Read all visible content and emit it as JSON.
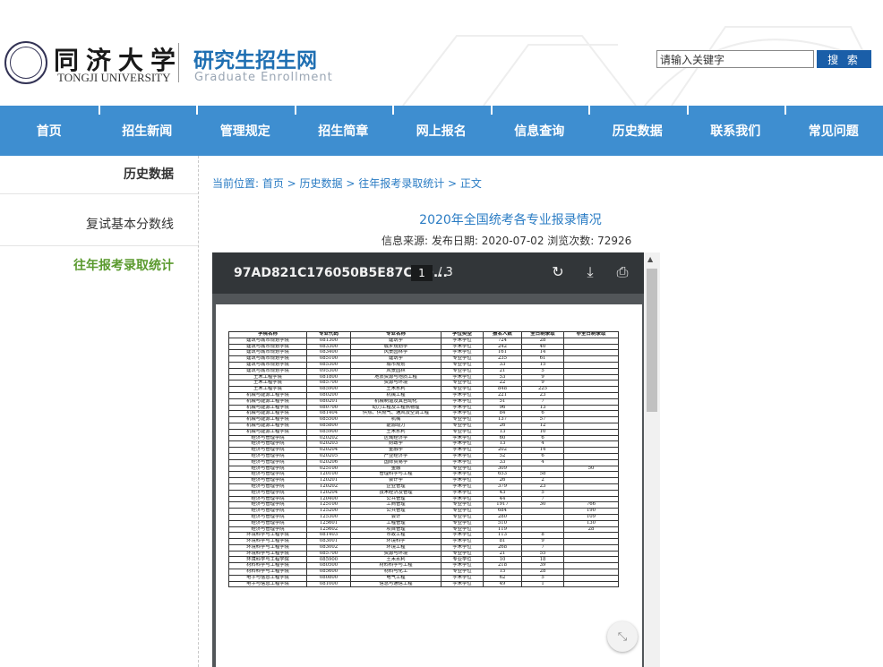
{
  "header": {
    "university_cn": "同济大学",
    "university_en": "TONGJI UNIVERSITY",
    "site_title": "研究生招生网",
    "site_subtitle": "Graduate Enrollment",
    "search_placeholder": "请输入关键字",
    "search_button": "搜 索"
  },
  "nav": [
    "首页",
    "招生新闻",
    "管理规定",
    "招生简章",
    "网上报名",
    "信息查询",
    "历史数据",
    "联系我们",
    "常见问题"
  ],
  "sidebar": {
    "heading": "历史数据",
    "items": [
      {
        "label": "复试基本分数线",
        "active": false
      },
      {
        "label": "往年报考录取统计",
        "active": true
      }
    ]
  },
  "breadcrumb": "当前位置:  首页 > 历史数据 > 往年报考录取统计 > 正文",
  "article": {
    "title": "2020年全国统考各专业报录情况",
    "meta": "信息来源:  发布日期: 2020-07-02 浏览次数: 72926"
  },
  "viewer": {
    "doc_name": "97AD821C176050B5E87CDD...",
    "page": "1",
    "total": "/ 3",
    "icons": {
      "rotate": "rotate-icon",
      "download": "download-icon",
      "print": "print-icon",
      "fit": "fit-page-icon"
    },
    "accent": "#323639"
  },
  "table": {
    "headers": [
      "学院名称",
      "专业代码",
      "专业名称",
      "学位类型",
      "报名人数",
      "全日制录取",
      "非全日制录取"
    ],
    "rows": [
      [
        "建筑与城市规划学院",
        "081300",
        "建筑学",
        "学术学位",
        "724",
        "28",
        ""
      ],
      [
        "建筑与城市规划学院",
        "083300",
        "城乡规划学",
        "学术学位",
        "242",
        "40",
        ""
      ],
      [
        "建筑与城市规划学院",
        "083400",
        "风景园林学",
        "学术学位",
        "161",
        "14",
        ""
      ],
      [
        "建筑与城市规划学院",
        "085100",
        "建筑学",
        "专业学位",
        "235",
        "61",
        ""
      ],
      [
        "建筑与城市规划学院",
        "085300",
        "城市规划",
        "专业学位",
        "33",
        "15",
        ""
      ],
      [
        "建筑与城市规划学院",
        "095300",
        "风景园林",
        "专业学位",
        "21",
        "5",
        ""
      ],
      [
        "土木工程学院",
        "081800",
        "地质资源与地质工程",
        "学术学位",
        "53",
        "9",
        ""
      ],
      [
        "土木工程学院",
        "085700",
        "资源与环境",
        "专业学位",
        "22",
        "9",
        ""
      ],
      [
        "土木工程学院",
        "085900",
        "土木水利",
        "专业学位",
        "848",
        "225",
        ""
      ],
      [
        "机械与能源工程学院",
        "080200",
        "机械工程",
        "学术学位",
        "221",
        "23",
        ""
      ],
      [
        "机械与能源工程学院",
        "080201",
        "机械制造及其自动化",
        "学术学位",
        "51",
        "7",
        ""
      ],
      [
        "机械与能源工程学院",
        "080700",
        "动力工程及工程热物理",
        "学术学位",
        "96",
        "13",
        ""
      ],
      [
        "机械与能源工程学院",
        "081404",
        "供热、供燃气、通风及空调工程",
        "学术学位",
        "84",
        "6",
        ""
      ],
      [
        "机械与能源工程学院",
        "085500",
        "机械",
        "专业学位",
        "137",
        "57",
        ""
      ],
      [
        "机械与能源工程学院",
        "085800",
        "能源动力",
        "专业学位",
        "26",
        "12",
        ""
      ],
      [
        "机械与能源工程学院",
        "085900",
        "土木水利",
        "专业学位",
        "13",
        "10",
        ""
      ],
      [
        "经济与管理学院",
        "020202",
        "区域经济学",
        "学术学位",
        "60",
        "6",
        ""
      ],
      [
        "经济与管理学院",
        "020203",
        "财政学",
        "学术学位",
        "13",
        "4",
        ""
      ],
      [
        "经济与管理学院",
        "020204",
        "金融学",
        "学术学位",
        "202",
        "14",
        ""
      ],
      [
        "经济与管理学院",
        "020205",
        "产业经济学",
        "学术学位",
        "52",
        "6",
        ""
      ],
      [
        "经济与管理学院",
        "020206",
        "国际贸易学",
        "学术学位",
        "33",
        "4",
        ""
      ],
      [
        "经济与管理学院",
        "025100",
        "金融",
        "专业学位",
        "309",
        "",
        "50"
      ],
      [
        "经济与管理学院",
        "120100",
        "管理科学与工程",
        "学术学位",
        "653",
        "58",
        ""
      ],
      [
        "经济与管理学院",
        "120201",
        "会计学",
        "学术学位",
        "26",
        "2",
        ""
      ],
      [
        "经济与管理学院",
        "120202",
        "企业管理",
        "学术学位",
        "379",
        "23",
        ""
      ],
      [
        "经济与管理学院",
        "120204",
        "技术经济及管理",
        "学术学位",
        "43",
        "5",
        ""
      ],
      [
        "经济与管理学院",
        "120400",
        "公共管理",
        "学术学位",
        "44",
        "7",
        ""
      ],
      [
        "经济与管理学院",
        "125100",
        "工商管理",
        "专业学位",
        "1917",
        "30",
        "766"
      ],
      [
        "经济与管理学院",
        "125200",
        "公共管理",
        "专业学位",
        "684",
        "",
        "190"
      ],
      [
        "经济与管理学院",
        "125300",
        "会计",
        "专业学位",
        "280",
        "",
        "109"
      ],
      [
        "经济与管理学院",
        "125601",
        "工程管理",
        "专业学位",
        "510",
        "",
        "130"
      ],
      [
        "经济与管理学院",
        "125602",
        "项目管理",
        "专业学位",
        "119",
        "",
        "28"
      ],
      [
        "环境科学与工程学院",
        "081403",
        "市政工程",
        "学术学位",
        "113",
        "8",
        ""
      ],
      [
        "环境科学与工程学院",
        "083001",
        "环境科学",
        "学术学位",
        "81",
        "9",
        ""
      ],
      [
        "环境科学与工程学院",
        "083002",
        "环境工程",
        "学术学位",
        "268",
        "7",
        ""
      ],
      [
        "环境科学与工程学院",
        "085700",
        "资源与环境",
        "专业学位",
        "21",
        "55",
        ""
      ],
      [
        "环境科学与工程学院",
        "085900",
        "土木水利",
        "专业学位",
        "10",
        "18",
        ""
      ],
      [
        "材料科学与工程学院",
        "080500",
        "材料科学与工程",
        "学术学位",
        "218",
        "39",
        ""
      ],
      [
        "材料科学与工程学院",
        "085600",
        "材料与化工",
        "专业学位",
        "15",
        "28",
        ""
      ],
      [
        "电子与信息工程学院",
        "080800",
        "电气工程",
        "学术学位",
        "62",
        "5",
        ""
      ],
      [
        "电子与信息工程学院",
        "081000",
        "信息与通信工程",
        "学术学位",
        "49",
        "1",
        ""
      ]
    ]
  }
}
